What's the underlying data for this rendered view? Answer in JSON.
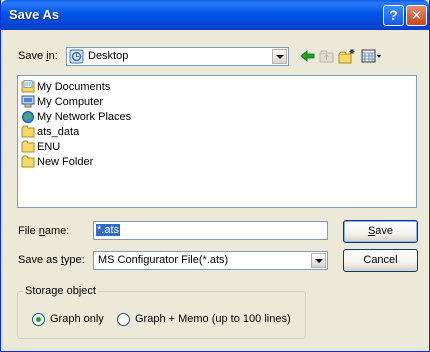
{
  "window": {
    "title": "Save As",
    "help_label": "?",
    "close_label": "✕"
  },
  "save_in": {
    "label_pre": "Save ",
    "label_hot": "i",
    "label_post": "n:",
    "value": "Desktop",
    "icon": "desktop-icon"
  },
  "toolbar": {
    "back_icon": "back-arrow-icon",
    "up_icon": "up-folder-icon",
    "new_folder_icon": "new-folder-icon",
    "views_icon": "views-menu-icon"
  },
  "files": [
    {
      "name": "My Documents",
      "icon": "my-documents-icon"
    },
    {
      "name": "My Computer",
      "icon": "my-computer-icon"
    },
    {
      "name": "My Network Places",
      "icon": "network-places-icon"
    },
    {
      "name": "ats_data",
      "icon": "folder-icon"
    },
    {
      "name": "ENU",
      "icon": "folder-icon"
    },
    {
      "name": "New Folder",
      "icon": "folder-icon"
    }
  ],
  "file_name": {
    "label_pre": "File ",
    "label_hot": "n",
    "label_post": "ame:",
    "value": "*.ats"
  },
  "save_type": {
    "label_pre": "Save as ",
    "label_hot": "t",
    "label_post": "ype:",
    "value": "MS Configurator File(*.ats)"
  },
  "buttons": {
    "save_hot": "S",
    "save_rest": "ave",
    "cancel": "Cancel"
  },
  "storage": {
    "title": "Storage object",
    "options": [
      {
        "label": "Graph only",
        "selected": true
      },
      {
        "label": "Graph + Memo (up to 100 lines)",
        "selected": false
      }
    ]
  },
  "colors": {
    "title_bar": "#0055e5",
    "selection": "#316ac5",
    "dialog_bg": "#ece9d8"
  }
}
